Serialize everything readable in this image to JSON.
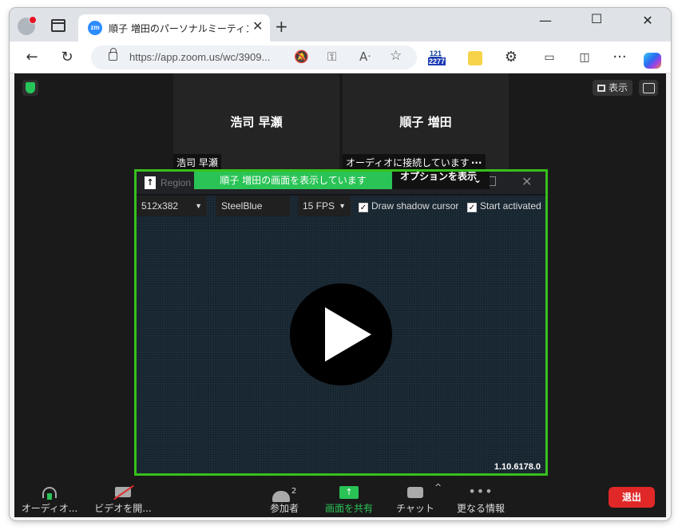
{
  "browser": {
    "tab_title": "順子 増田のパーソナルミーティングルー",
    "tab_favicon": "zm",
    "url": "https://app.zoom.us/wc/3909...",
    "ext_badge_top": "121",
    "ext_badge_bottom": "2277"
  },
  "zoom": {
    "view_button": "表示",
    "tiles": [
      {
        "name": "浩司 早瀬",
        "label": "浩司 早瀬"
      },
      {
        "name": "順子 増田",
        "label": "オーディオに接続しています",
        "label_more": "···"
      }
    ],
    "share": {
      "region_text": "Region",
      "banner": "順子 増田の画面を表示しています",
      "options": "オプションを表示",
      "size_select": "512x382",
      "color_select": "SteelBlue",
      "fps_select": "15 FPS",
      "check_shadow": "Draw shadow cursor",
      "check_start": "Start activated",
      "version": "1.10.6178.0"
    },
    "toolbar": {
      "audio": "オーディオ...",
      "video": "ビデオを開...",
      "participants": "参加者",
      "participants_count": "2",
      "share": "画面を共有",
      "chat": "チャット",
      "more": "更なる情報",
      "leave": "退出"
    }
  }
}
